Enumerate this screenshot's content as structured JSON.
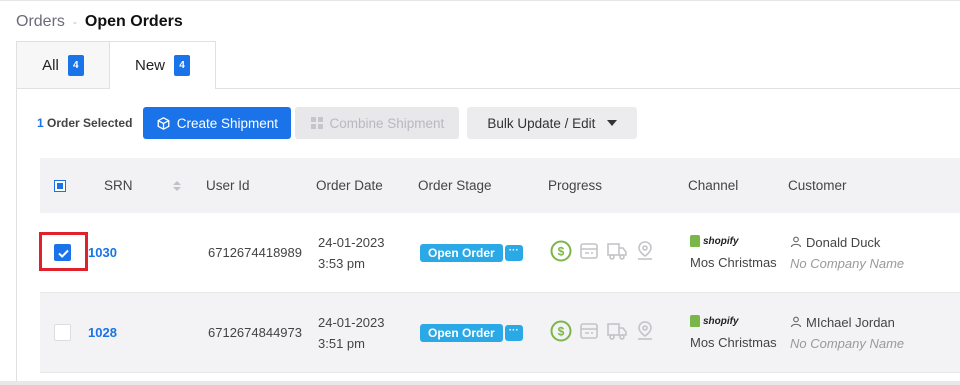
{
  "breadcrumb": {
    "root": "Orders",
    "separator": "-",
    "current": "Open Orders"
  },
  "tabs": [
    {
      "label": "All",
      "count": "4"
    },
    {
      "label": "New",
      "count": "4"
    }
  ],
  "toolbar": {
    "selected_count": "1",
    "selected_label": "Order Selected",
    "create_shipment": "Create Shipment",
    "combine_shipment": "Combine Shipment",
    "bulk_update": "Bulk Update / Edit"
  },
  "table": {
    "headers": {
      "srn": "SRN",
      "user_id": "User Id",
      "order_date": "Order Date",
      "order_stage": "Order Stage",
      "progress": "Progress",
      "channel": "Channel",
      "customer": "Customer"
    },
    "rows": [
      {
        "selected": true,
        "srn": "1030",
        "user_id": "6712674418989",
        "date": "24-01-2023",
        "time": "3:53 pm",
        "stage": "Open Order",
        "stage_more": "···",
        "channel_logo": "shopify",
        "channel_store": "Mos Christmas",
        "customer_name": "Donald Duck",
        "customer_company": "No Company Name"
      },
      {
        "selected": false,
        "srn": "1028",
        "user_id": "6712674844973",
        "date": "24-01-2023",
        "time": "3:51 pm",
        "stage": "Open Order",
        "stage_more": "···",
        "channel_logo": "shopify",
        "channel_store": "Mos Christmas",
        "customer_name": "MIchael Jordan",
        "customer_company": "No Company Name"
      }
    ]
  },
  "icons": {
    "progress": [
      "payment-icon",
      "invoice-icon",
      "shipping-truck-icon",
      "location-pin-icon"
    ],
    "customer": "user-icon"
  },
  "colors": {
    "primary": "#1a73e8",
    "stage_pill": "#2ba8e6",
    "progress_done": "#7ab648",
    "progress_pending": "#c4c4c8",
    "highlight": "#e0202a"
  }
}
